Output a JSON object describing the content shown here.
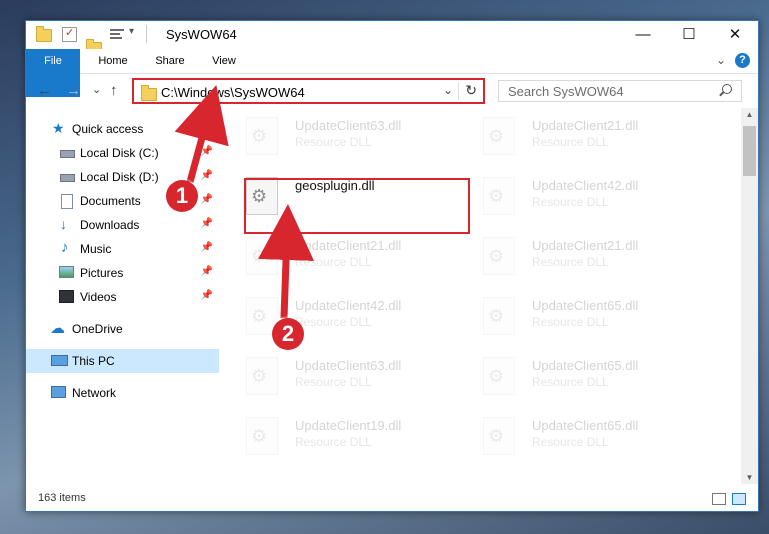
{
  "window": {
    "title": "SysWOW64"
  },
  "ribbon": {
    "tabs": [
      "File",
      "Home",
      "Share",
      "View"
    ],
    "help": "?"
  },
  "controls": {
    "minimize": "—",
    "maximize": "☐",
    "close": "✕"
  },
  "nav": {
    "back": "←",
    "forward": "→",
    "recent": "⌄",
    "up": "↑",
    "address": "C:\\Windows\\SysWOW64",
    "refresh": "↻",
    "search_placeholder": "Search SysWOW64"
  },
  "sidebar": {
    "items": [
      {
        "label": "Quick access",
        "icon": "star-icon",
        "pinned": false
      },
      {
        "label": "Local Disk (C:)",
        "icon": "drive-icon",
        "pinned": true
      },
      {
        "label": "Local Disk (D:)",
        "icon": "drive-icon",
        "pinned": true
      },
      {
        "label": "Documents",
        "icon": "documents-icon",
        "pinned": true
      },
      {
        "label": "Downloads",
        "icon": "download-icon",
        "pinned": true
      },
      {
        "label": "Music",
        "icon": "music-icon",
        "pinned": true
      },
      {
        "label": "Pictures",
        "icon": "pictures-icon",
        "pinned": true
      },
      {
        "label": "Videos",
        "icon": "videos-icon",
        "pinned": true
      },
      {
        "label": "OneDrive",
        "icon": "cloud-icon",
        "pinned": false
      },
      {
        "label": "This PC",
        "icon": "computer-icon",
        "pinned": false,
        "selected": true
      },
      {
        "label": "Network",
        "icon": "network-icon",
        "pinned": false
      }
    ],
    "pin_glyph": "📌"
  },
  "files": {
    "highlighted": {
      "name": "geosplugin.dll",
      "type": ""
    },
    "faded": [
      {
        "name": "UpdateClient63.dll",
        "type": "Resource DLL"
      },
      {
        "name": "UpdateClient21.dll",
        "type": "Resource DLL"
      },
      {
        "name": "UpdateClient42.dll",
        "type": "Resource DLL"
      },
      {
        "name": "UpdateClient21.dll",
        "type": "Resource DLL"
      },
      {
        "name": "UpdateClient21.dll",
        "type": "Resource DLL"
      },
      {
        "name": "UpdateClient42.dll",
        "type": "Resource DLL"
      },
      {
        "name": "UpdateClient65.dll",
        "type": "Resource DLL"
      },
      {
        "name": "UpdateClient63.dll",
        "type": "Resource DLL"
      },
      {
        "name": "UpdateClient65.dll",
        "type": "Resource DLL"
      },
      {
        "name": "UpdateClient19.dll",
        "type": "Resource DLL"
      },
      {
        "name": "UpdateClient65.dll",
        "type": "Resource DLL"
      }
    ]
  },
  "status": {
    "count": "163 items"
  },
  "callouts": [
    "1",
    "2"
  ],
  "colors": {
    "accent": "#1979ca",
    "highlight": "#d7262e",
    "selection": "#cce8ff"
  }
}
